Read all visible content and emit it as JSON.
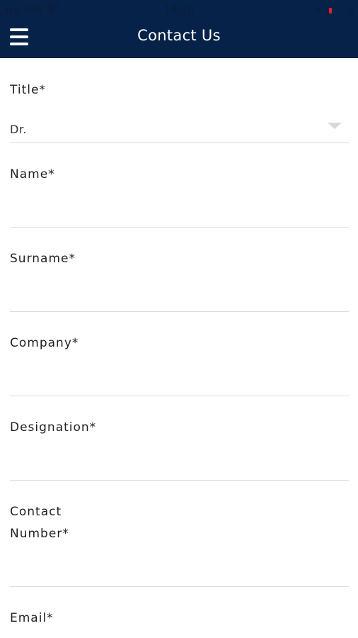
{
  "status_bar": {
    "carrier": "No SIM",
    "time": "14:10"
  },
  "header": {
    "title": "Contact Us"
  },
  "form": {
    "title": {
      "label": "Title*",
      "value": "Dr."
    },
    "name": {
      "label": "Name*",
      "value": ""
    },
    "surname": {
      "label": "Surname*",
      "value": ""
    },
    "company": {
      "label": "Company*",
      "value": ""
    },
    "designation": {
      "label": "Designation*",
      "value": ""
    },
    "contact_number": {
      "label_line1": "Contact",
      "label_line2": "Number*",
      "value": ""
    },
    "email": {
      "label": "Email*",
      "value": ""
    }
  },
  "colors": {
    "header_bg": "#062248",
    "divider": "#dcdcdc",
    "battery_low": "#e0202a"
  }
}
